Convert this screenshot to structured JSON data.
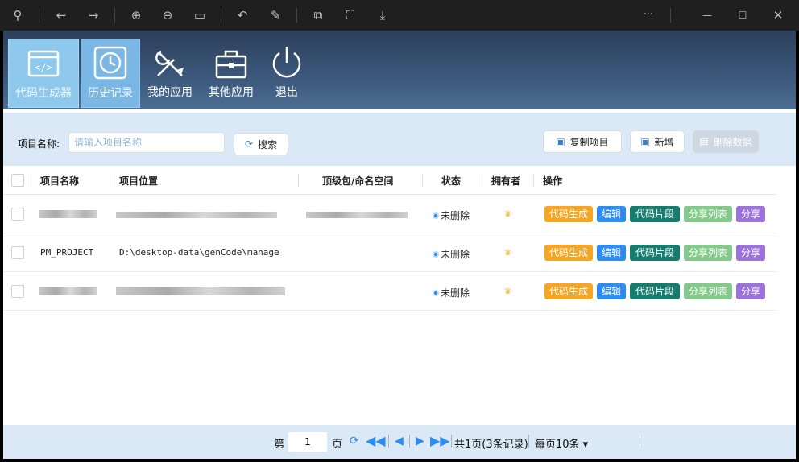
{
  "window": {
    "toolbar_icons": [
      "pin-icon",
      "back-icon",
      "forward-icon",
      "zoom-in-icon",
      "zoom-out-icon",
      "fit-icon",
      "rotate-icon",
      "edit-icon",
      "copy-icon",
      "crop-icon",
      "save-icon"
    ],
    "more": "···",
    "minimize": "—",
    "maximize": "☐",
    "close": "✕"
  },
  "nav": {
    "items": [
      {
        "label": "代码生成器",
        "icon": "code-icon"
      },
      {
        "label": "历史记录",
        "icon": "clock-icon"
      },
      {
        "label": "我的应用",
        "icon": "tools-icon"
      },
      {
        "label": "其他应用",
        "icon": "toolbox-icon"
      },
      {
        "label": "退出",
        "icon": "power-icon"
      }
    ]
  },
  "search": {
    "label": "项目名称:",
    "placeholder": "请输入项目名称",
    "search_button": "搜索",
    "copy_button": "复制项目",
    "add_button": "新增",
    "delete_button": "删除数据"
  },
  "table": {
    "headers": {
      "name": "项目名称",
      "location": "项目位置",
      "package": "顶级包/命名空间",
      "status": "状态",
      "owner": "拥有者",
      "actions": "操作"
    },
    "rows": [
      {
        "name": "",
        "location": "",
        "package": "",
        "status": "未删除"
      },
      {
        "name": "PM_PROJECT",
        "location": "D:\\desktop-data\\genCode\\manage",
        "package": "",
        "status": "未删除"
      },
      {
        "name": "",
        "location": "",
        "package": "",
        "status": "未删除"
      }
    ],
    "action_labels": {
      "generate": "代码生成",
      "edit": "编辑",
      "snippet": "代码片段",
      "share_list": "分享列表",
      "share": "分享"
    }
  },
  "pager": {
    "page_prefix": "第",
    "page_value": "1",
    "page_suffix": "页",
    "total": "共1页(3条记录)",
    "per_page": "每页10条 ▾"
  }
}
